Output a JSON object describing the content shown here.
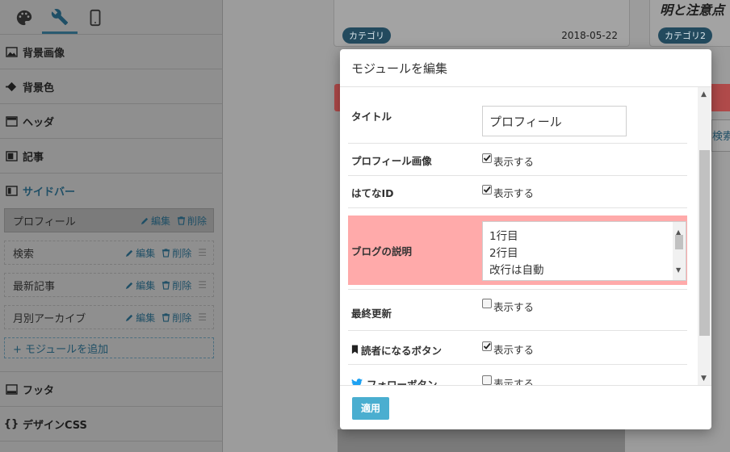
{
  "sidebar": {
    "sections_top": [
      {
        "label": "背景画像",
        "icon": "image-icon"
      },
      {
        "label": "背景色",
        "icon": "paint-bucket-icon"
      },
      {
        "label": "ヘッダ",
        "icon": "layout-icon"
      },
      {
        "label": "記事",
        "icon": "layout-icon"
      },
      {
        "label": "サイドバー",
        "icon": "layout-icon"
      }
    ],
    "modules": [
      {
        "name": "プロフィール",
        "selected": true
      },
      {
        "name": "検索",
        "selected": false
      },
      {
        "name": "最新記事",
        "selected": false
      },
      {
        "name": "月別アーカイブ",
        "selected": false
      }
    ],
    "edit_label": "編集",
    "delete_label": "削除",
    "add_module_label": "+ モジュールを追加",
    "sections_bottom": [
      {
        "label": "フッタ",
        "icon": "layout-icon"
      },
      {
        "label": "デザインCSS",
        "icon": "braces-icon"
      }
    ]
  },
  "preview": {
    "card1_category": "カテゴリ",
    "card1_date": "2018-05-22",
    "card2_title": "明と注意点",
    "card2_category": "カテゴリ2",
    "search_fragment": "検索"
  },
  "modal": {
    "title": "モジュールを編集",
    "fields": {
      "title_label": "タイトル",
      "title_value": "プロフィール",
      "profile_image_label": "プロフィール画像",
      "hatena_id_label": "はてなID",
      "blog_desc_label": "ブログの説明",
      "blog_desc_lines": [
        "1行目",
        "2行目",
        "改行は自動"
      ],
      "last_updated_label": "最終更新",
      "reader_button_label": "読者になるボタン",
      "follow_button_label": "フォローボタン",
      "show_label": "表示する"
    },
    "checks": {
      "profile_image": true,
      "hatena_id": true,
      "last_updated": false,
      "reader_button": true,
      "follow_button": false
    },
    "apply_label": "適用"
  },
  "colors": {
    "accent": "#4aaed0",
    "highlight": "#ffaaaa",
    "link": "#1f4f66"
  }
}
